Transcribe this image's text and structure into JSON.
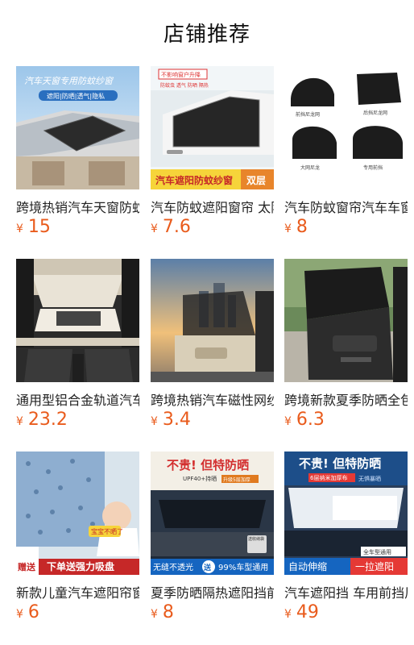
{
  "page": {
    "title": "店铺推荐"
  },
  "colors": {
    "price": "#e95b1c",
    "title": "#111111"
  },
  "products": [
    {
      "name": "跨境热销汽车天窗防蚊纱窗",
      "currency": "¥",
      "price": "15",
      "image_text": {
        "top": "汽车天窗专用防蚊纱窗",
        "sub": "遮阳|防晒|透气|隐私"
      }
    },
    {
      "name": "汽车防蚊遮阳窗帘 太阳挡",
      "currency": "¥",
      "price": "7.6",
      "image_text": {
        "top": "不影响窗户升降",
        "sub": "防蚊虫 透气 防晒 隔热",
        "bottom": "汽车遮阳防蚊纱窗",
        "tag": "双层"
      }
    },
    {
      "name": "汽车防蚊窗帘汽车车窗纱网",
      "currency": "¥",
      "price": "8",
      "image_text": {
        "l1": "前挡尼龙网",
        "l2": "后挡尼龙网",
        "l3": "大网尼龙",
        "l4": "专用前挡"
      }
    },
    {
      "name": "通用型铝合金轨道汽车窗帘",
      "currency": "¥",
      "price": "23.2",
      "image_text": {}
    },
    {
      "name": "跨境热销汽车磁性网纱窗帘",
      "currency": "¥",
      "price": "3.4",
      "image_text": {}
    },
    {
      "name": "跨境新款夏季防晒全包遮阳帘",
      "currency": "¥",
      "price": "6.3",
      "image_text": {}
    },
    {
      "name": "新款儿童汽车遮阳帘窗帘",
      "currency": "¥",
      "price": "6",
      "image_text": {
        "baby": "宝宝不晒了",
        "gift": "赠送",
        "bottom": "下单送强力吸盘"
      }
    },
    {
      "name": "夏季防晒隔热遮阳挡前挡",
      "currency": "¥",
      "price": "8",
      "image_text": {
        "top": "不贵! 但特防晒",
        "sub": "UPF40+持晒",
        "sub2": "升级5层加厚",
        "b1": "无缝不透光",
        "b2": "送",
        "b3": "99%车型通用",
        "small": "送收纳袋"
      }
    },
    {
      "name": "汽车遮阳挡 车用前挡风玻璃",
      "currency": "¥",
      "price": "49",
      "image_text": {
        "top": "不贵! 但特防晒",
        "sub": "6层纳米加厚布",
        "sub2": "无惧暴晒",
        "tag": "全车型通用",
        "b1": "自动伸缩",
        "b2": "一拉遮阳"
      }
    }
  ]
}
